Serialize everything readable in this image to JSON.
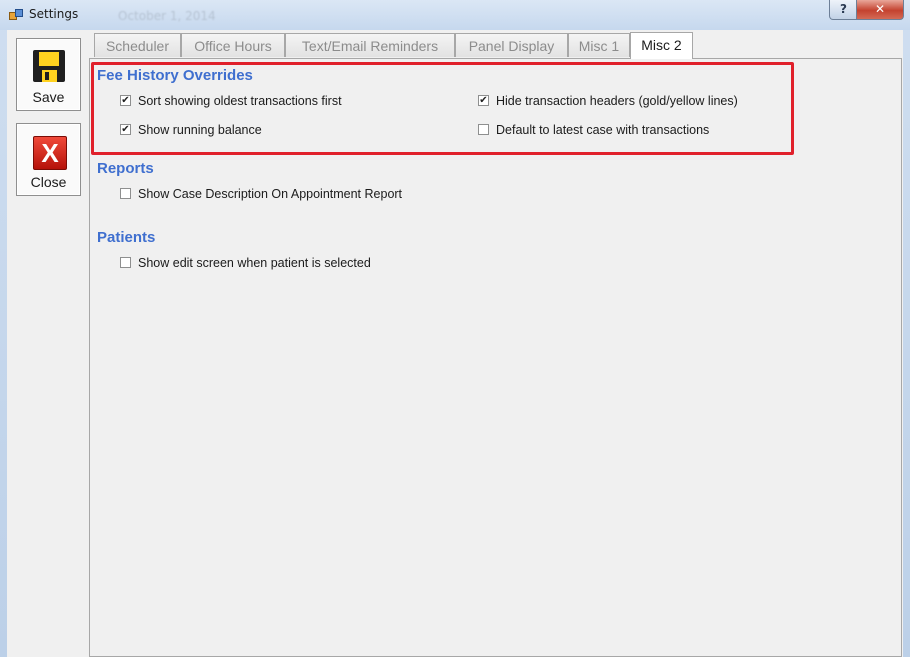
{
  "window": {
    "title": "Settings",
    "title_ghost": "October 1, 2014",
    "help_label": "?",
    "close_label": "✕"
  },
  "sidebar": {
    "save_label": "Save",
    "close_label": "Close",
    "close_glyph": "X"
  },
  "tabs": [
    {
      "label": "Scheduler"
    },
    {
      "label": "Office Hours"
    },
    {
      "label": "Text/Email Reminders"
    },
    {
      "label": "Panel Display"
    },
    {
      "label": "Misc 1"
    },
    {
      "label": "Misc 2",
      "active": true
    }
  ],
  "sections": {
    "fee_history": {
      "title": "Fee History Overrides",
      "options": [
        {
          "label": "Sort showing oldest transactions first",
          "checked": "✔"
        },
        {
          "label": "Show running balance",
          "checked": "✔"
        },
        {
          "label": "Hide transaction headers (gold/yellow lines)",
          "checked": "✔"
        },
        {
          "label": "Default to latest case with transactions",
          "checked": ""
        }
      ]
    },
    "reports": {
      "title": "Reports",
      "options": [
        {
          "label": "Show Case Description On Appointment Report",
          "checked": ""
        }
      ]
    },
    "patients": {
      "title": "Patients",
      "options": [
        {
          "label": "Show edit screen when patient is selected",
          "checked": ""
        }
      ]
    }
  },
  "colors": {
    "section_heading": "#3f6fcf",
    "highlight_border": "#e0202b"
  }
}
